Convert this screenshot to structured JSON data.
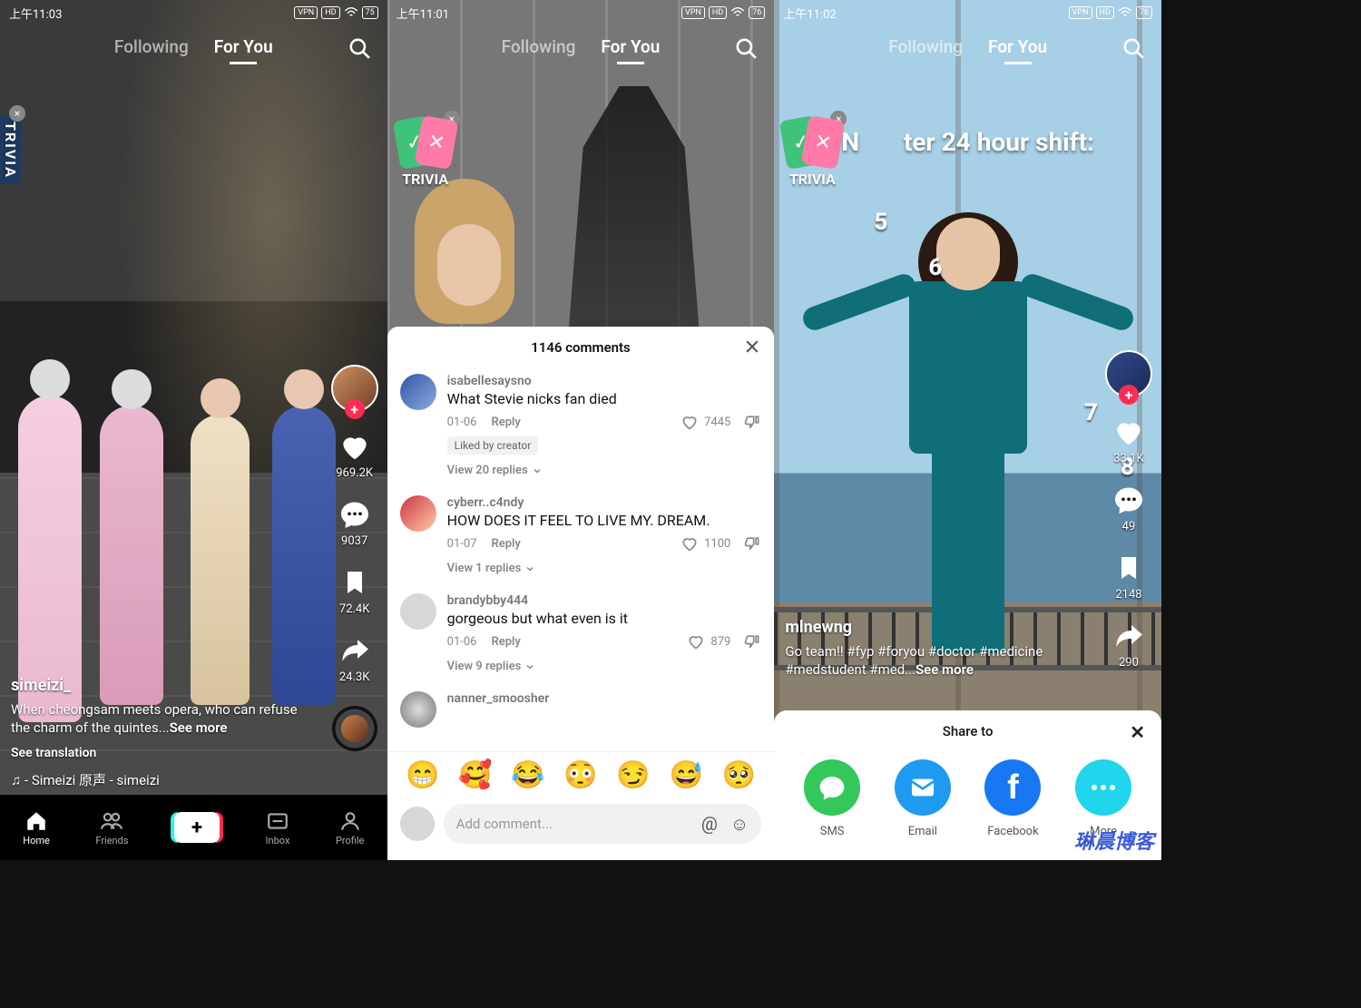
{
  "watermark": "琳晨博客",
  "trivia_label": "TRIVIA",
  "tabs": {
    "following": "Following",
    "for_you": "For You"
  },
  "phone1": {
    "status_time": "上午11:03",
    "status_vpn": "VPN",
    "status_hd": "HD",
    "status_battery": "75",
    "user": "simeizi_",
    "caption_a": "When cheongsam meets opera, who can refuse the charm of the quintes...",
    "see_more": "See more",
    "see_translation": "See translation",
    "sound": "♫ - Simeizi  原声 - simeizi",
    "likes": "969.2K",
    "comments": "9037",
    "saves": "72.4K",
    "shares": "24.3K",
    "nav": {
      "home": "Home",
      "friends": "Friends",
      "inbox": "Inbox",
      "profile": "Profile"
    }
  },
  "phone2": {
    "status_time": "上午11:01",
    "status_vpn": "VPN",
    "status_hd": "HD",
    "status_battery": "76",
    "sheet_title": "1146 comments",
    "comments": [
      {
        "user": "isabellesaysno",
        "text": "What Stevie nicks fan died",
        "date": "01-06",
        "reply": "Reply",
        "likes": "7445",
        "liked_by_creator": "Liked by creator",
        "view_replies": "View 20 replies"
      },
      {
        "user": "cyberr..c4ndy",
        "text": "HOW DOES IT FEEL TO LIVE MY. DREAM.",
        "date": "01-07",
        "reply": "Reply",
        "likes": "1100",
        "view_replies": "View 1 replies"
      },
      {
        "user": "brandybby444",
        "text": "gorgeous but what even is it",
        "date": "01-06",
        "reply": "Reply",
        "likes": "879",
        "view_replies": "View 9 replies"
      },
      {
        "user": "nanner_smoosher",
        "text": "",
        "date": "",
        "reply": "",
        "likes": "",
        "view_replies": ""
      }
    ],
    "reactions": [
      "😁",
      "🥰",
      "😂",
      "😳",
      "😏",
      "😅",
      "🥺"
    ],
    "comment_placeholder": "Add comment..."
  },
  "phone3": {
    "status_time": "上午11:02",
    "status_vpn": "VPN",
    "status_hd": "HD",
    "status_battery": "76",
    "overlay_prefix": "N",
    "overlay_rest": "ter 24 hour shift:",
    "numbers": {
      "n5": "5",
      "n6": "6",
      "n7": "7",
      "n8": "8"
    },
    "user": "mlnewng",
    "caption": "Go team!! #fyp #foryou #doctor #medicine #medstudent #med...",
    "see_more": "See more",
    "likes": "33.1K",
    "comments": "49",
    "saves": "2148",
    "shares": "290",
    "share_title": "Share to",
    "share_items": {
      "sms": "SMS",
      "email": "Email",
      "facebook": "Facebook",
      "more": "More"
    }
  }
}
